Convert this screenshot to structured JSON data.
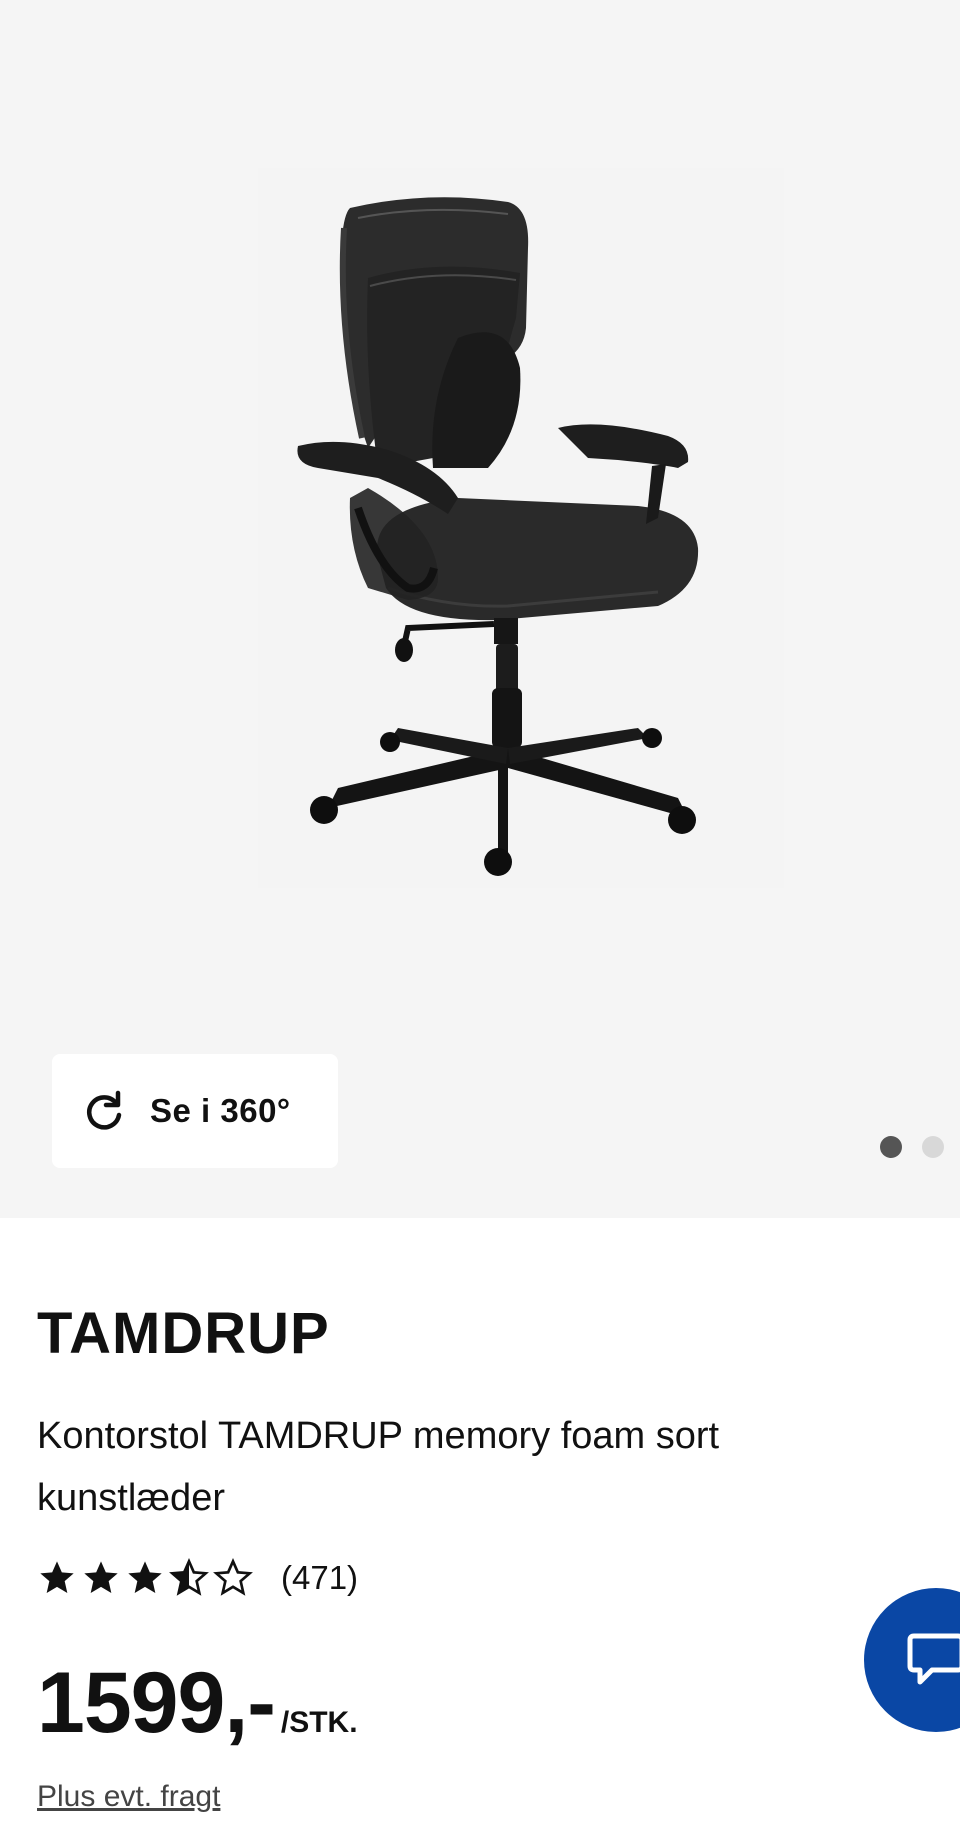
{
  "gallery": {
    "view360_label": "Se i 360°",
    "image_count": 2,
    "active_index": 0,
    "image_alt": "Kontorstol TAMDRUP sort"
  },
  "product": {
    "brand": "TAMDRUP",
    "title": "Kontorstol TAMDRUP memory foam sort kunstlæder",
    "rating": {
      "value": 3.5,
      "max": 5,
      "count_label": "(471)"
    },
    "price": {
      "value": "1599,-",
      "unit": "/STK."
    },
    "shipping_link": "Plus evt. fragt"
  },
  "colors": {
    "chat_button": "#0a47a5",
    "gallery_bg": "#f5f5f5"
  },
  "icons": {
    "view360": "rotate-icon",
    "chat": "chat-bubble-icon"
  }
}
